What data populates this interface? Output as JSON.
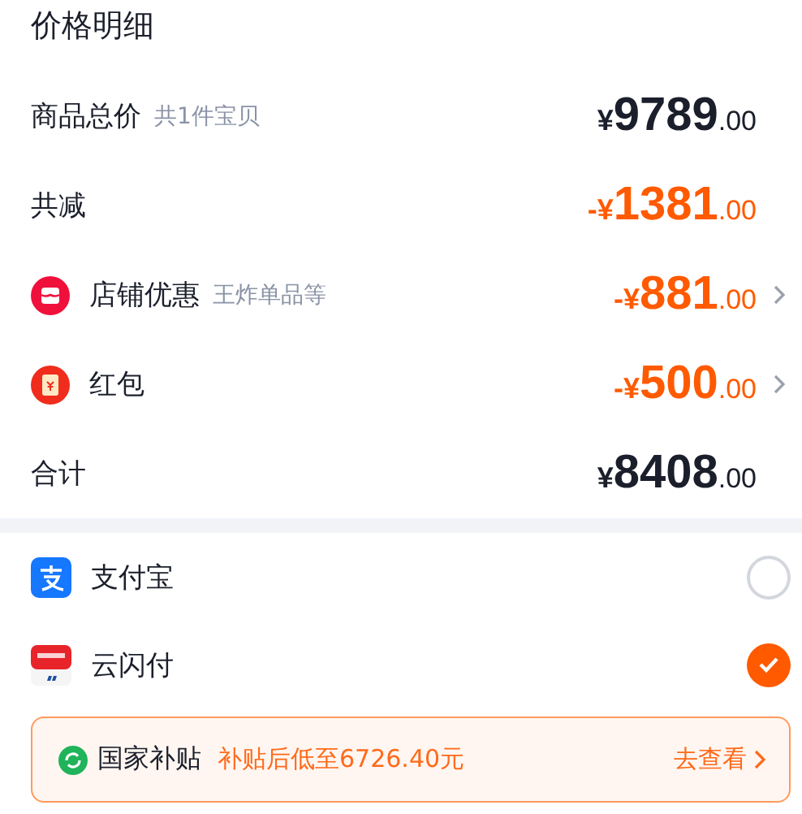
{
  "title": "价格明细",
  "price_rows": [
    {
      "kind": "total",
      "label": "商品总价",
      "note": "共1件宝贝",
      "prefix": "¥",
      "integer": "9789",
      "decimal": ".00"
    },
    {
      "kind": "reduction",
      "label": "共减",
      "prefix": "-¥",
      "integer": "1381",
      "decimal": ".00"
    },
    {
      "kind": "discount",
      "label": "店铺优惠",
      "note": "王炸单品等",
      "prefix": "-¥",
      "integer": "881",
      "decimal": ".00"
    },
    {
      "kind": "discount",
      "label": "红包",
      "prefix": "-¥",
      "integer": "500",
      "decimal": ".00"
    },
    {
      "kind": "total",
      "label": "合计",
      "prefix": "¥",
      "integer": "8408",
      "decimal": ".00"
    }
  ],
  "payment_methods": [
    {
      "label": "支付宝",
      "selected": false
    },
    {
      "label": "云闪付",
      "selected": true
    }
  ],
  "subsidy_banner": {
    "label": "国家补贴",
    "detail": "补贴后低至6726.40元",
    "link": "去查看"
  }
}
